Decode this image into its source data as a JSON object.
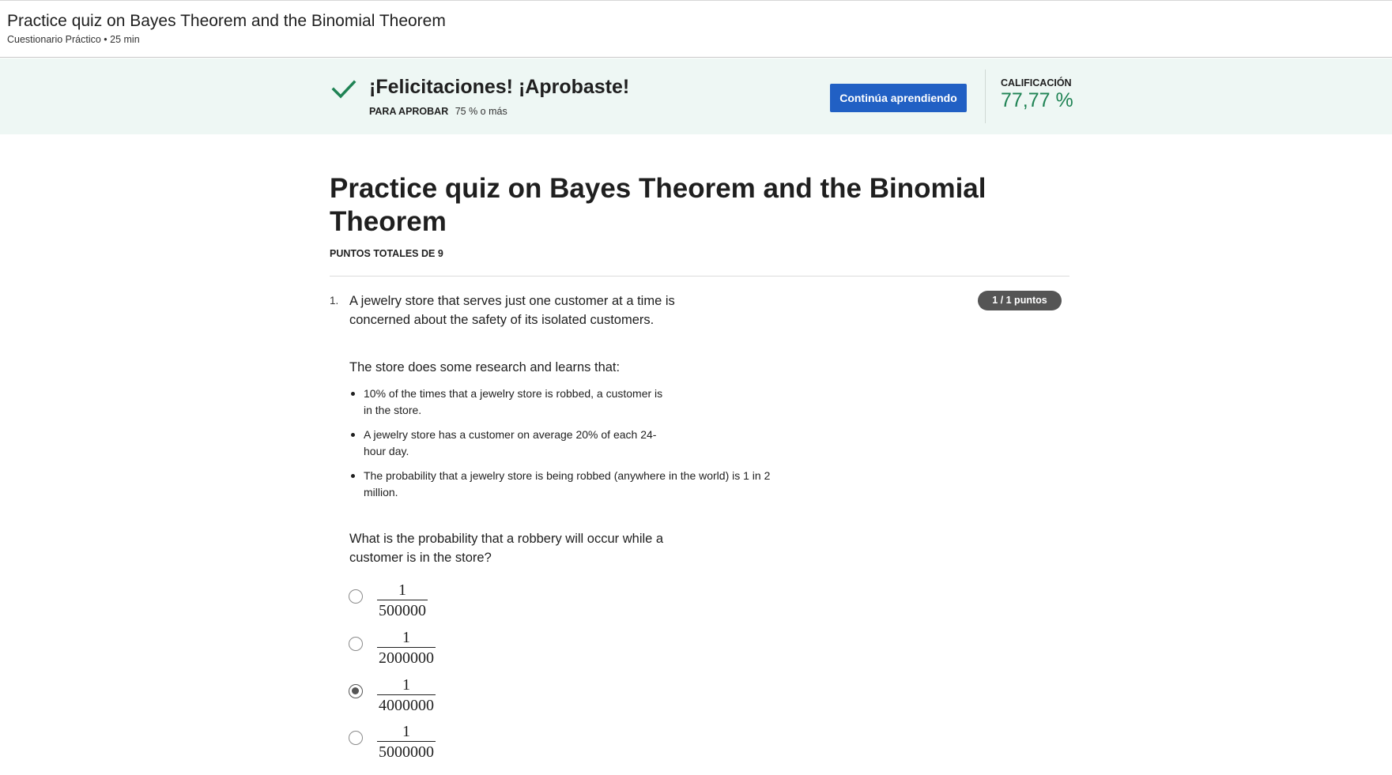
{
  "header": {
    "title": "Practice quiz on Bayes Theorem and the Binomial Theorem",
    "subtitle": "Cuestionario Práctico • 25 min"
  },
  "result_banner": {
    "message": "¡Felicitaciones! ¡Aprobaste!",
    "pass_label": "PARA APROBAR",
    "pass_value": "75 % o más",
    "continue_label": "Continúa aprendiendo",
    "grade_label": "CALIFICACIÓN",
    "grade_value": "77,77 %",
    "success_color": "#1f8354",
    "button_color": "#2160c4"
  },
  "quiz": {
    "title": "Practice quiz on Bayes Theorem and the Binomial Theorem",
    "total_points": "PUNTOS TOTALES DE 9"
  },
  "question1": {
    "number": "1.",
    "points": "1 / 1 puntos",
    "intro": "A jewelry store that serves just one customer at a time is concerned about the safety of its isolated customers.",
    "research": "The store does some research and learns that:",
    "facts": [
      "10% of the times that a jewelry store is robbed, a customer is in the store.",
      "A jewelry store has a customer on average 20% of each 24-hour day.",
      "The probability that a jewelry store is being robbed (anywhere in the world) is 1 in 2 million."
    ],
    "ask": "What is the probability that a robbery will occur while a customer is in the store?",
    "options": [
      {
        "numerator": "1",
        "denominator": "500000",
        "selected": false
      },
      {
        "numerator": "1",
        "denominator": "2000000",
        "selected": false
      },
      {
        "numerator": "1",
        "denominator": "4000000",
        "selected": true
      },
      {
        "numerator": "1",
        "denominator": "5000000",
        "selected": false
      }
    ]
  }
}
